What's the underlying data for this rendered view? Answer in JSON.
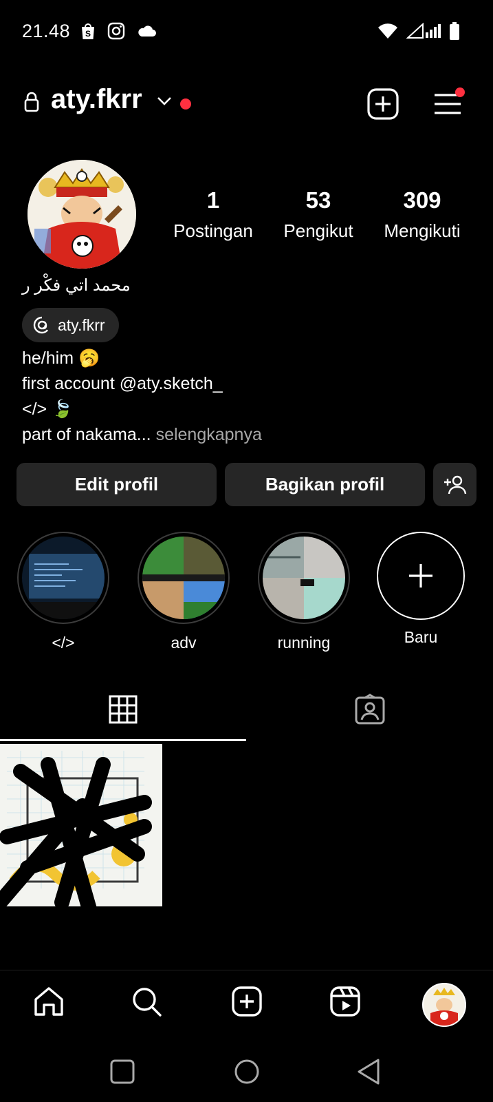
{
  "status_bar": {
    "time": "21.48",
    "left_icons": [
      "shopee-bag-icon",
      "instagram-icon",
      "cloud-icon"
    ],
    "right_icons": [
      "wifi-icon",
      "signal-icon",
      "battery-icon"
    ]
  },
  "header": {
    "username": "aty.fkrr",
    "has_notification_dot": true,
    "accent_red": "#ff3040"
  },
  "profile": {
    "full_name": "محمد اتي فكْر ر",
    "threads_handle": "aty.fkrr",
    "stats": [
      {
        "value": "1",
        "label": "Postingan"
      },
      {
        "value": "53",
        "label": "Pengikut"
      },
      {
        "value": "309",
        "label": "Mengikuti"
      }
    ],
    "bio": {
      "line1": "he/him 🥱",
      "line2": "first account @aty.sketch_",
      "line3": "</> 🍃",
      "line4": "part of nakama...",
      "more": "selengkapnya"
    }
  },
  "actions": {
    "edit": "Edit profil",
    "share": "Bagikan profil"
  },
  "highlights": [
    {
      "label": "</>"
    },
    {
      "label": "adv"
    },
    {
      "label": "running"
    },
    {
      "label": "Baru"
    }
  ],
  "tabs": [
    "grid-icon",
    "tagged-icon"
  ],
  "bottom_nav": [
    "home-icon",
    "search-icon",
    "create-icon",
    "reels-icon",
    "profile-avatar"
  ],
  "system_nav": [
    "recents-icon",
    "home-circle-icon",
    "back-icon"
  ]
}
